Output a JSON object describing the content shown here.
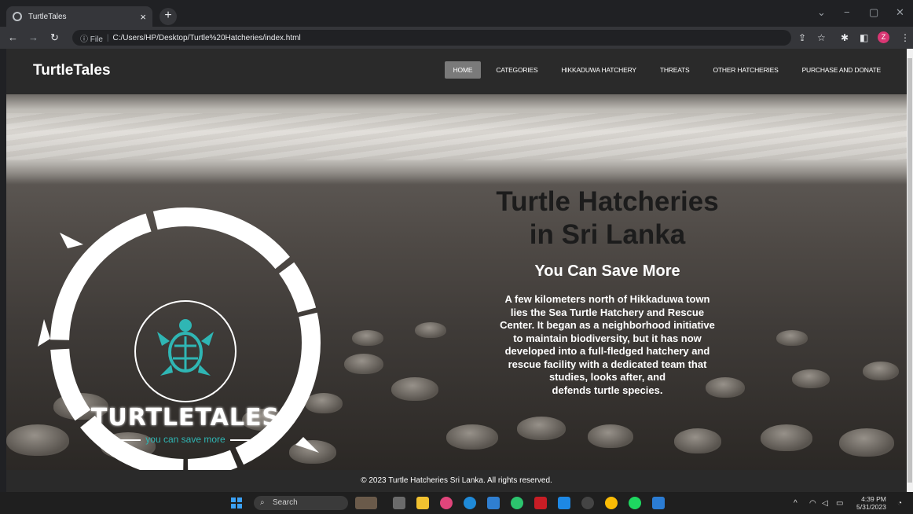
{
  "browser": {
    "tab_title": "TurtleTales",
    "tab_close": "×",
    "new_tab": "+",
    "omnibox_info": "ⓘ File",
    "url": "C:/Users/HP/Desktop/Turtle%20Hatcheries/index.html",
    "profile_initial": "Z"
  },
  "site": {
    "brand": "TurtleTales",
    "menu": [
      {
        "label": "HOME"
      },
      {
        "label": "CATEGORIES"
      },
      {
        "label": "HIKKADUWA HATCHERY"
      },
      {
        "label": "THREATS"
      },
      {
        "label": "OTHER HATCHERIES"
      },
      {
        "label": "PURCHASE AND DONATE"
      }
    ]
  },
  "logo": {
    "wordmark": "TURTLETALES",
    "tagline": "you can save more"
  },
  "hero": {
    "title_line1": "Turtle Hatcheries",
    "title_line2": "in Sri Lanka",
    "subtitle": "You Can Save More",
    "description_lines": [
      "A few kilometers north of Hikkaduwa town",
      "lies the Sea Turtle Hatchery and Rescue",
      "Center. It began as a neighborhood initiative",
      "to maintain biodiversity, but it has now",
      "developed into a full-fledged hatchery and",
      "rescue facility with a dedicated team that",
      "studies, looks after, and",
      "defends turtle species."
    ]
  },
  "footer": {
    "copyright": "© 2023 Turtle Hatcheries Sri Lanka. All rights reserved."
  },
  "taskbar": {
    "search_label": "Search",
    "time": "4:39 PM",
    "date": "5/31/2023"
  },
  "colors": {
    "nav_bg": "#2a2a2a",
    "active_menu": "#7a7a7a",
    "logo_teal": "#2fb6b4"
  }
}
